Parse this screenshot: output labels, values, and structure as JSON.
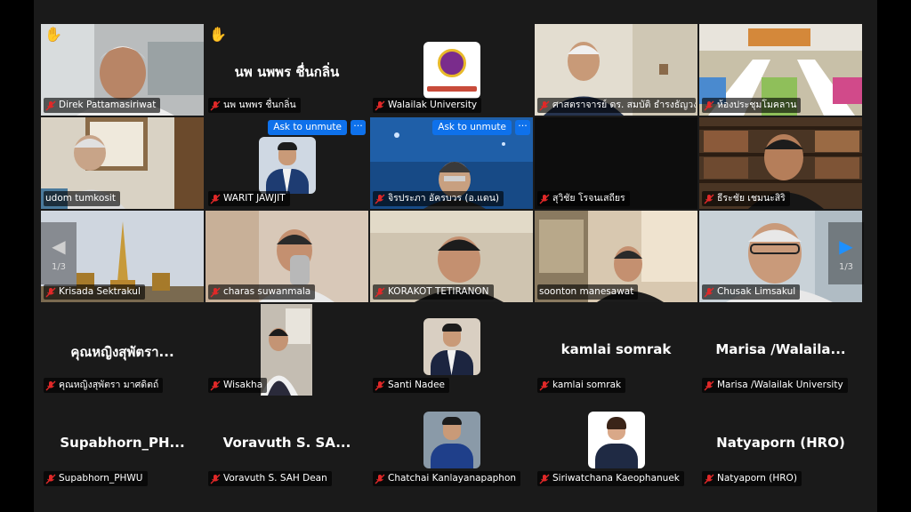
{
  "page_indicator": "1/3",
  "nav": {
    "prev_icon": "◀",
    "next_icon": "▶"
  },
  "colors": {
    "accent_blue": "#0e71eb",
    "active_speaker": "#23d959",
    "muted_mic": "#e02828"
  },
  "tiles": [
    {
      "name": "Direk Pattamasiriwat",
      "muted": true,
      "raised_hand": true,
      "kind": "video"
    },
    {
      "name": "นพ นพพร ชื่นกลิ่น",
      "display_name": "นพ นพพร ชื่นกลิ่น",
      "muted": true,
      "raised_hand": true,
      "kind": "name"
    },
    {
      "name": "Walailak University",
      "muted": true,
      "kind": "logo"
    },
    {
      "name": "ศาสตราจารย์ ดร. สมบัติ ธำรงธัญวงศ์",
      "muted": true,
      "kind": "video"
    },
    {
      "name": "ห้องประชุมโมคลาน",
      "muted": true,
      "kind": "video"
    },
    {
      "name": "udom tumkosit",
      "muted": false,
      "kind": "video"
    },
    {
      "name": "WARIT JAWJIT",
      "muted": true,
      "kind": "avatar",
      "unmute_label": "Ask to unmute",
      "more_label": "···"
    },
    {
      "name": "จิรประภา อัครบวร (อ.แดน)",
      "muted": true,
      "kind": "video",
      "unmute_label": "Ask to unmute",
      "more_label": "···"
    },
    {
      "name": "สุวิชัย โรจนเสถียร",
      "muted": true,
      "kind": "dark"
    },
    {
      "name": "ธีระชัย เชมนะสิริ",
      "muted": true,
      "kind": "video"
    },
    {
      "name": "Krisada Sektrakul",
      "muted": true,
      "kind": "video"
    },
    {
      "name": "charas suwanmala",
      "muted": true,
      "kind": "video"
    },
    {
      "name": "KORAKOT TETIRANON",
      "muted": true,
      "kind": "video"
    },
    {
      "name": "soonton manesawat",
      "muted": false,
      "kind": "video",
      "active": true
    },
    {
      "name": "Chusak Limsakul",
      "muted": true,
      "kind": "video"
    },
    {
      "name": "คุณหญิงสุพัตรา มาศดิตถ์",
      "display_name": "คุณหญิงสุพัตรา...",
      "muted": true,
      "kind": "name"
    },
    {
      "name": "Wisakha",
      "muted": true,
      "kind": "video"
    },
    {
      "name": "Santi Nadee",
      "muted": true,
      "kind": "avatar"
    },
    {
      "name": "kamlai somrak",
      "display_name": "kamlai somrak",
      "muted": true,
      "kind": "name"
    },
    {
      "name": "Marisa /Walailak University",
      "display_name": "Marisa  /Walaila...",
      "muted": true,
      "kind": "name"
    },
    {
      "name": "Supabhorn_PHWU",
      "display_name": "Supabhorn_PH...",
      "muted": true,
      "kind": "name"
    },
    {
      "name": "Voravuth S. SAH Dean",
      "display_name": "Voravuth S. SA...",
      "muted": true,
      "kind": "name"
    },
    {
      "name": "Chatchai Kanlayanapaphon",
      "muted": true,
      "kind": "avatar"
    },
    {
      "name": "Siriwatchana Kaeophanuek",
      "muted": true,
      "kind": "avatar"
    },
    {
      "name": "Natyaporn (HRO)",
      "display_name": "Natyaporn (HRO)",
      "muted": true,
      "kind": "name"
    }
  ]
}
